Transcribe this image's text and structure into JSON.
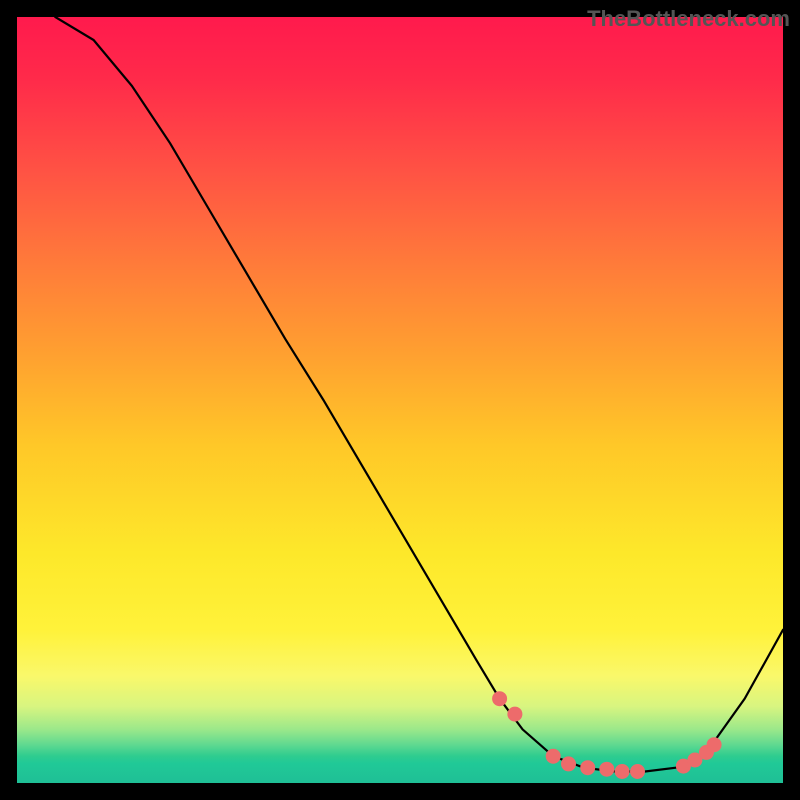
{
  "watermark": "TheBottleneck.com",
  "chart_data": {
    "type": "line",
    "title": "",
    "xlabel": "",
    "ylabel": "",
    "xlim": [
      0,
      100
    ],
    "ylim": [
      0,
      100
    ],
    "series": [
      {
        "name": "bottleneck-curve",
        "x": [
          5,
          10,
          15,
          20,
          25,
          30,
          35,
          40,
          45,
          50,
          55,
          60,
          63,
          66,
          70,
          74,
          78,
          82,
          86,
          90,
          95,
          100
        ],
        "values": [
          100,
          97,
          91,
          83.5,
          75,
          66.5,
          58,
          50,
          41.5,
          33,
          24.5,
          16,
          11,
          7,
          3.5,
          2,
          1.5,
          1.5,
          2,
          4,
          11,
          20
        ]
      }
    ],
    "markers": {
      "name": "highlight-dots",
      "x": [
        63,
        65,
        70,
        72,
        74.5,
        77,
        79,
        81,
        87,
        88.5,
        90,
        91
      ],
      "values": [
        11,
        9,
        3.5,
        2.5,
        2,
        1.8,
        1.5,
        1.5,
        2.2,
        3,
        4,
        5
      ]
    },
    "gradient_stops": [
      {
        "offset": 0.0,
        "color": "#ff1a4d"
      },
      {
        "offset": 0.5,
        "color": "#ffc828"
      },
      {
        "offset": 0.8,
        "color": "#fff23a"
      },
      {
        "offset": 1.0,
        "color": "#1fbf96"
      }
    ]
  }
}
